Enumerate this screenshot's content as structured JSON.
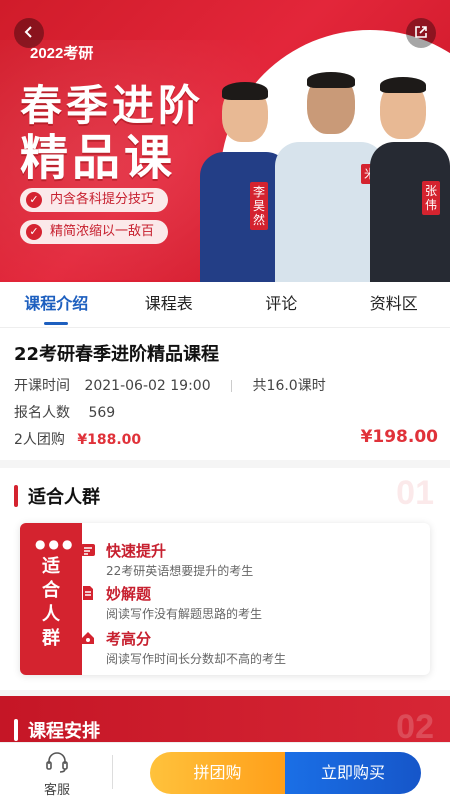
{
  "banner": {
    "year_tag": "2022考研",
    "title_line1": "春季进阶",
    "title_line2": "精品课",
    "features": [
      "内含各科提分技巧",
      "精简浓缩以一敌百"
    ],
    "teachers": [
      "李昊然",
      "米",
      "张伟"
    ]
  },
  "tabs": [
    "课程介绍",
    "课程表",
    "评论",
    "资料区"
  ],
  "course": {
    "title": "22考研春季进阶精品课程",
    "start_label": "开课时间",
    "start_time": "2021-06-02 19:00",
    "hours": "共16.0课时",
    "enrolled_label": "报名人数",
    "enrolled_count": "569",
    "group_label": "2人团购",
    "group_price": "¥188.00",
    "price": "¥198.00"
  },
  "audience": {
    "heading": "适合人群",
    "number": "01",
    "side_label": "适合人群",
    "items": [
      {
        "title": "快速提升",
        "desc": "22考研英语想要提升的考生"
      },
      {
        "title": "妙解题",
        "desc": "阅读写作没有解题思路的考生"
      },
      {
        "title": "考高分",
        "desc": "阅读写作时间长分数却不高的考生"
      }
    ]
  },
  "schedule": {
    "heading": "课程安排",
    "number": "02"
  },
  "bottom": {
    "service_label": "客服",
    "group_buy_label": "拼团购",
    "buy_now_label": "立即购买"
  },
  "colors": {
    "brand_red": "#d4232f",
    "tab_blue": "#1d5fbf",
    "price_red": "#e0323a",
    "buy_blue": "#1a6fe6",
    "group_orange": "#ffb22c"
  },
  "icons": [
    "back-icon",
    "share-icon",
    "check-icon",
    "headset-icon",
    "boost-icon",
    "doc-icon",
    "pen-icon"
  ]
}
